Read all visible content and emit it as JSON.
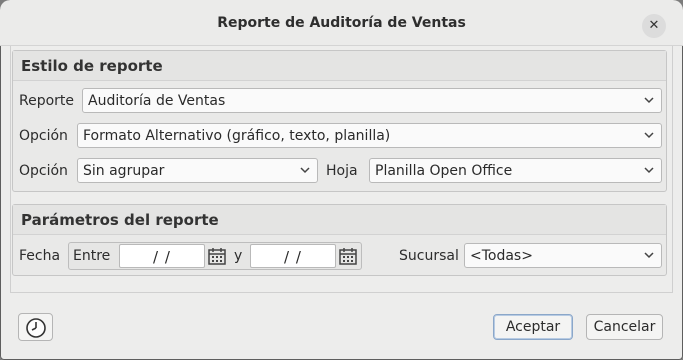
{
  "window": {
    "title": "Reporte de Auditoría de Ventas",
    "close_icon": "close-icon"
  },
  "style_section": {
    "title": "Estilo de reporte",
    "report_label": "Reporte",
    "report_value": "Auditoría de Ventas",
    "option1_label": "Opción",
    "option1_value": "Formato Alternativo (gráfico, texto, planilla)",
    "option2_label": "Opción",
    "option2_value": "Sin agrupar",
    "sheet_label": "Hoja",
    "sheet_value": "Planilla Open Office"
  },
  "params_section": {
    "title": "Parámetros del reporte",
    "date_label": "Fecha",
    "between_label": "Entre",
    "from_value": "/ /",
    "and_label": "y",
    "to_value": "/ /",
    "branch_label": "Sucursal",
    "branch_value": "<Todas>",
    "calendar_icon": "calendar-icon"
  },
  "footer": {
    "history_icon": "clock-icon",
    "accept_label": "Aceptar",
    "cancel_label": "Cancelar"
  }
}
